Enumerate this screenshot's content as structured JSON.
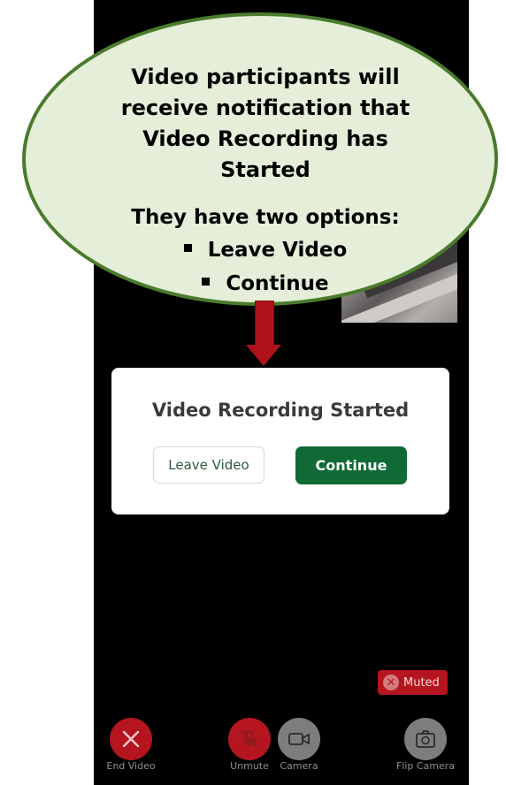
{
  "callout": {
    "line1": "Video participants will",
    "line2": "receive notification that",
    "line3": "Video Recording has",
    "line4": "Started",
    "options_heading": "They have two options:",
    "option1": "Leave Video",
    "option2": "Continue"
  },
  "dialog": {
    "title": "Video Recording Started",
    "leave_label": "Leave Video",
    "continue_label": "Continue"
  },
  "status": {
    "muted_label": "Muted"
  },
  "controls": {
    "end_video": "End Video",
    "unmute": "Unmute",
    "camera": "Camera",
    "flip_camera": "Flip Camera"
  },
  "colors": {
    "accent_green": "#0f6a35",
    "danger_red": "#b5151f",
    "bubble_fill": "#e4eed8",
    "bubble_border": "#4a7b2c"
  }
}
